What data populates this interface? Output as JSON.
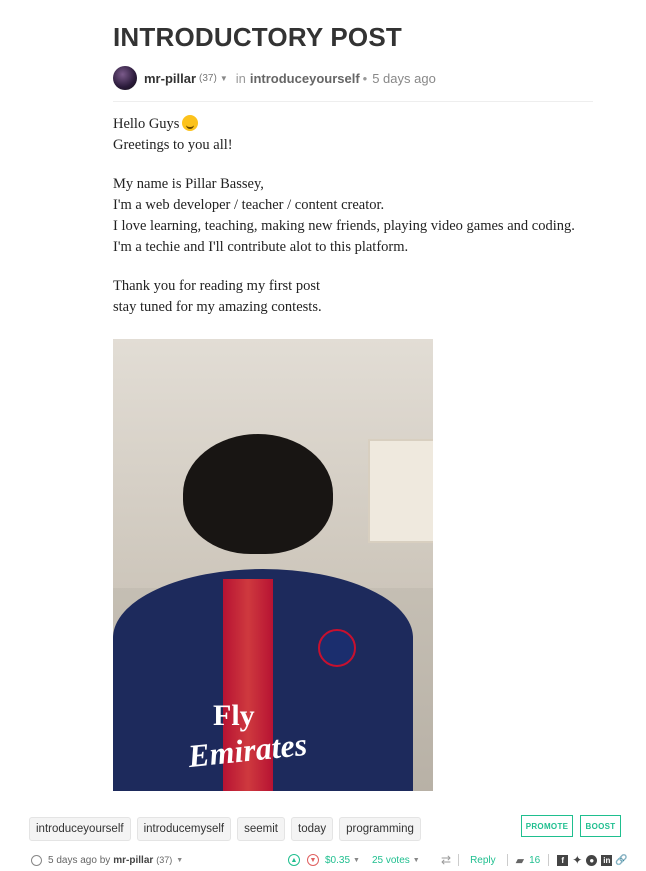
{
  "post": {
    "title": "INTRODUCTORY POST",
    "author": "mr-pillar",
    "reputation": "(37)",
    "in_label": "in",
    "community": "introduceyourself",
    "time": "5 days ago",
    "body": [
      [
        "Hello Guys",
        "Greetings to you all!"
      ],
      [
        "My name is Pillar Bassey,",
        "I'm a web developer / teacher / content creator.",
        "I love learning, teaching, making new friends, playing video games and coding.",
        "I'm a techie and I'll contribute alot to this platform."
      ],
      [
        "Thank you for reading my first post",
        "stay tuned for my amazing contests."
      ]
    ],
    "photo_text": {
      "line1": "Fly",
      "line2": "Emirates"
    }
  },
  "tags": [
    "introduceyourself",
    "introducemyself",
    "seemit",
    "today",
    "programming"
  ],
  "actions": {
    "promote": "PROMOTE",
    "boost": "BOOST"
  },
  "footer": {
    "time": "5 days ago by",
    "author": "mr-pillar",
    "reputation": "(37)",
    "payout": "$0.35",
    "votes": "25 votes",
    "reply": "Reply",
    "comments": "16"
  },
  "icons": [
    "clock-icon",
    "upvote-icon",
    "downvote-icon",
    "resteem-icon",
    "comment-icon",
    "facebook-icon",
    "twitter-icon",
    "reddit-icon",
    "linkedin-icon",
    "link-icon"
  ],
  "colors": {
    "accent": "#1fbf8f",
    "downvote": "#e06060"
  }
}
